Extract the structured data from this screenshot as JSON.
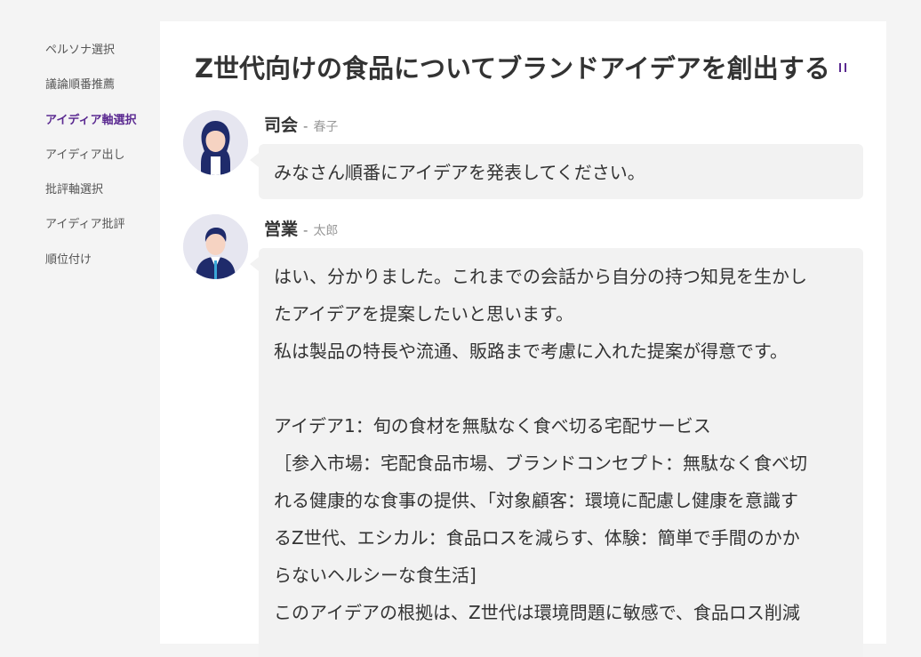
{
  "sidebar": {
    "items": [
      {
        "label": "ペルソナ選択",
        "active": false
      },
      {
        "label": "議論順番推薦",
        "active": false
      },
      {
        "label": "アイディア軸選択",
        "active": true
      },
      {
        "label": "アイディア出し",
        "active": false
      },
      {
        "label": "批評軸選択",
        "active": false
      },
      {
        "label": "アイディア批評",
        "active": false
      },
      {
        "label": "順位付け",
        "active": false
      }
    ]
  },
  "main": {
    "title": "Z世代向けの食品についてブランドアイデアを創出する",
    "messages": [
      {
        "role": "司会",
        "separator": "-",
        "person": "春子",
        "text": "みなさん順番にアイデアを発表してください。"
      },
      {
        "role": "営業",
        "separator": "-",
        "person": "太郎",
        "lines": [
          "はい、分かりました。これまでの会話から自分の持つ知見を生かし",
          "たアイデアを提案したいと思います。",
          "私は製品の特長や流通、販路まで考慮に入れた提案が得意です。",
          "",
          "アイデア1：旬の食材を無駄なく食べ切る宅配サービス",
          "［参入市場：宅配食品市場、ブランドコンセプト：無駄なく食べ切",
          "れる健康的な食事の提供、「対象顧客：環境に配慮し健康を意識す",
          "るZ世代、エシカル：食品ロスを減らす、体験：簡単で手間のかか",
          "らないヘルシーな食生活]",
          "このアイデアの根拠は、Z世代は環境問題に敏感で、食品ロス削減"
        ]
      }
    ]
  },
  "colors": {
    "accent": "#5b2a91",
    "page_bg": "#f4f4f4",
    "bubble_bg": "#f2f2f2"
  }
}
